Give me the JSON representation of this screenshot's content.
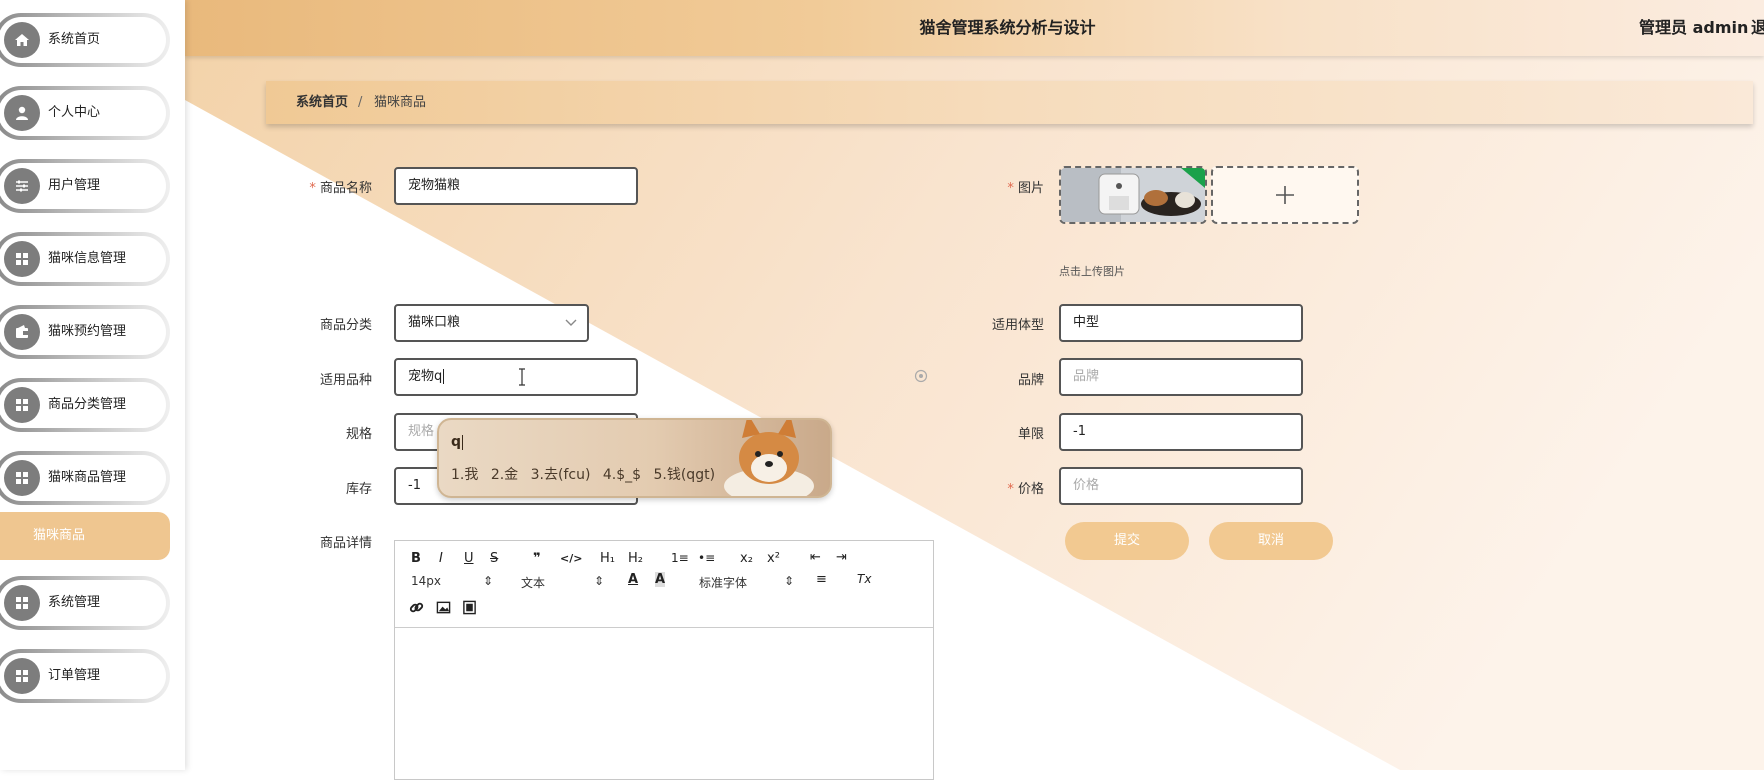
{
  "header": {
    "title": "猫舍管理系统分析与设计",
    "admin": "管理员 admin",
    "logout": "退"
  },
  "sidebar": {
    "items": [
      {
        "label": "系统首页",
        "icon": "home-icon"
      },
      {
        "label": "个人中心",
        "icon": "user-icon"
      },
      {
        "label": "用户管理",
        "icon": "sliders-icon"
      },
      {
        "label": "猫咪信息管理",
        "icon": "grid-icon"
      },
      {
        "label": "猫咪预约管理",
        "icon": "wallet-icon"
      },
      {
        "label": "商品分类管理",
        "icon": "grid-icon"
      },
      {
        "label": "猫咪商品管理",
        "icon": "grid-icon"
      },
      {
        "label": "系统管理",
        "icon": "grid-icon"
      },
      {
        "label": "订单管理",
        "icon": "grid-icon"
      }
    ],
    "active_sub": "猫咪商品"
  },
  "breadcrumb": {
    "home": "系统首页",
    "separator": "/",
    "current": "猫咪商品"
  },
  "form": {
    "name": {
      "label": "商品名称",
      "required": "*",
      "value": "宠物猫粮"
    },
    "image": {
      "label": "图片",
      "required": "*",
      "hint": "点击上传图片"
    },
    "category": {
      "label": "商品分类",
      "value": "猫咪口粮"
    },
    "body_type": {
      "label": "适用体型",
      "value": "中型"
    },
    "breed": {
      "label": "适用品种",
      "value": "宠物q"
    },
    "brand": {
      "label": "品牌",
      "placeholder": "品牌"
    },
    "spec": {
      "label": "规格",
      "placeholder": "规格"
    },
    "limit": {
      "label": "单限",
      "value": "-1"
    },
    "stock": {
      "label": "库存",
      "value": "-1"
    },
    "price": {
      "label": "价格",
      "required": "*",
      "placeholder": "价格"
    },
    "detail": {
      "label": "商品详情"
    }
  },
  "buttons": {
    "submit": "提交",
    "cancel": "取消"
  },
  "editor": {
    "bold": "B",
    "italic": "I",
    "underline": "U",
    "strike": "S",
    "quote": "❞",
    "code": "</>",
    "h1": "H₁",
    "h2": "H₂",
    "ordered_list": "1≡",
    "bullet_list": "•≡",
    "subscript": "x₂",
    "superscript": "x²",
    "outdent": "⇤",
    "indent": "⇥",
    "font_size": "14px",
    "block_type": "文本",
    "font_family": "标准字体",
    "align": "≡",
    "clear_format": "Tx"
  },
  "ime": {
    "input": "q",
    "candidates": [
      "1.我",
      "2.金",
      "3.去(fcu)",
      "4.$_$",
      "5.钱(qgt)"
    ]
  },
  "colors": {
    "accent": "#efc690",
    "header_start": "#e9b97c",
    "required": "#e0684d"
  }
}
